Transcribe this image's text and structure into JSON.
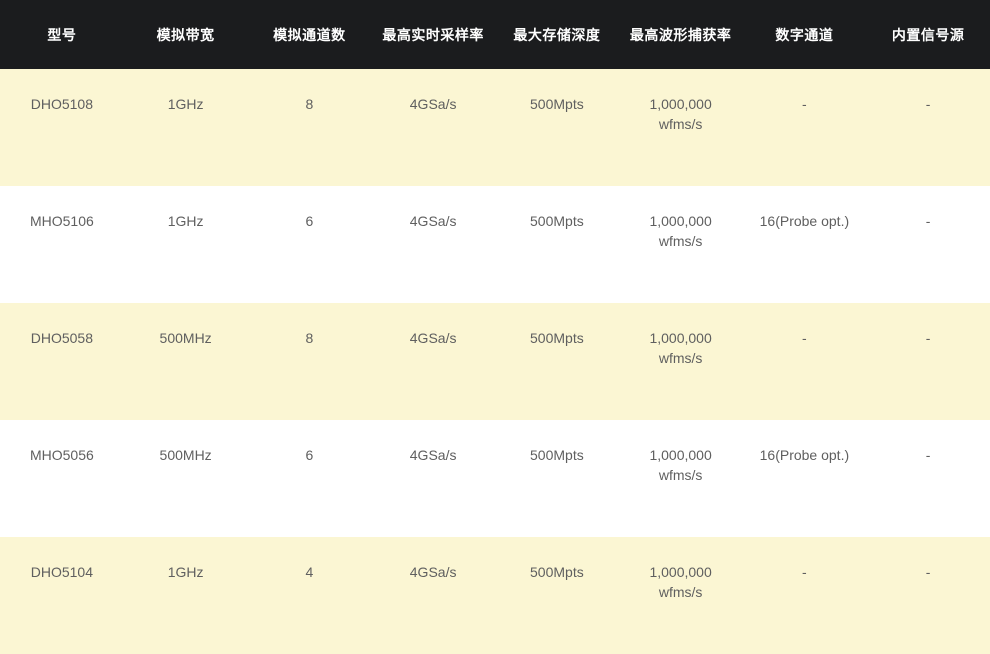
{
  "header": [
    "型号",
    "模拟带宽",
    "模拟通道数",
    "最高实时采样率",
    "最大存储深度",
    "最高波形捕获率",
    "数字通道",
    "内置信号源"
  ],
  "rows": [
    {
      "model": "DHO5108",
      "bandwidth": "1GHz",
      "channels": "8",
      "sample_rate": "4GSa/s",
      "memory": "500Mpts",
      "capture_1": "1,000,000",
      "capture_2": "wfms/s",
      "digital": "-",
      "generator": "-"
    },
    {
      "model": "MHO5106",
      "bandwidth": "1GHz",
      "channels": "6",
      "sample_rate": "4GSa/s",
      "memory": "500Mpts",
      "capture_1": "1,000,000",
      "capture_2": "wfms/s",
      "digital": "16(Probe opt.)",
      "generator": "-"
    },
    {
      "model": "DHO5058",
      "bandwidth": "500MHz",
      "channels": "8",
      "sample_rate": "4GSa/s",
      "memory": "500Mpts",
      "capture_1": "1,000,000",
      "capture_2": "wfms/s",
      "digital": "-",
      "generator": "-"
    },
    {
      "model": "MHO5056",
      "bandwidth": "500MHz",
      "channels": "6",
      "sample_rate": "4GSa/s",
      "memory": "500Mpts",
      "capture_1": "1,000,000",
      "capture_2": "wfms/s",
      "digital": "16(Probe opt.)",
      "generator": "-"
    },
    {
      "model": "DHO5104",
      "bandwidth": "1GHz",
      "channels": "4",
      "sample_rate": "4GSa/s",
      "memory": "500Mpts",
      "capture_1": "1,000,000",
      "capture_2": "wfms/s",
      "digital": "-",
      "generator": "-"
    }
  ],
  "colors": {
    "header_bg": "#1b1c1e",
    "header_text": "#ffffff",
    "row_odd_bg": "#fbf6d3",
    "row_even_bg": "#ffffff",
    "cell_text": "#5f5f5f"
  }
}
